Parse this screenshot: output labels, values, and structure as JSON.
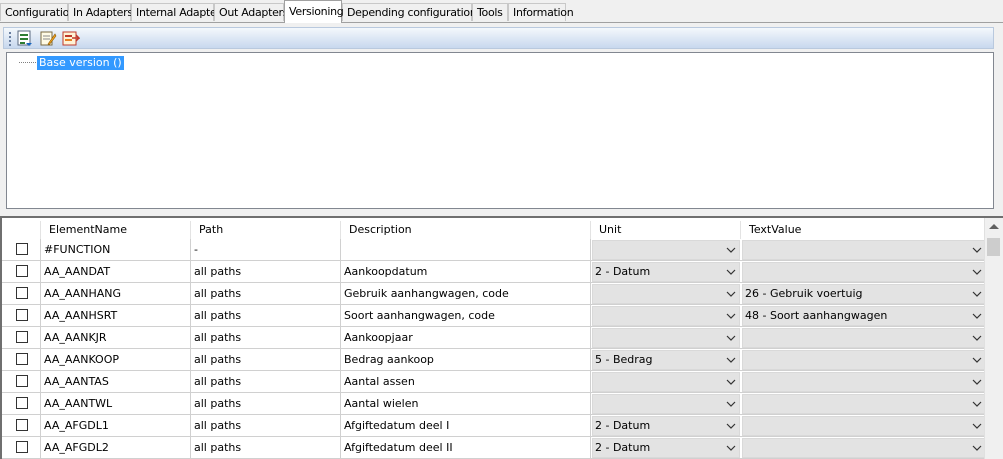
{
  "tabs": [
    "Configuration",
    "In Adapters",
    "Internal Adapter",
    "Out Adapters",
    "Versioning",
    "Depending configurations",
    "Tools",
    "Information"
  ],
  "active_tab": "Versioning",
  "toolbar": {
    "buttons": [
      {
        "icon": "export-data-icon"
      },
      {
        "icon": "edit-document-icon"
      },
      {
        "icon": "import-version-icon"
      }
    ]
  },
  "tree": {
    "nodes": [
      {
        "label": "Base version ()",
        "selected": true
      }
    ]
  },
  "grid": {
    "columns": [
      "",
      "ElementName",
      "Path",
      "Description",
      "Unit",
      "TextValue"
    ],
    "rows": [
      {
        "checked": false,
        "name": "#FUNCTION",
        "path": "-",
        "description": "",
        "unit": "",
        "text_value": ""
      },
      {
        "checked": false,
        "name": "AA_AANDAT",
        "path": "all paths",
        "description": "Aankoopdatum",
        "unit": "2 - Datum",
        "text_value": ""
      },
      {
        "checked": false,
        "name": "AA_AANHANG",
        "path": "all paths",
        "description": "Gebruik aanhangwagen, code",
        "unit": "",
        "text_value": "26 - Gebruik voertuig"
      },
      {
        "checked": false,
        "name": "AA_AANHSRT",
        "path": "all paths",
        "description": "Soort aanhangwagen, code",
        "unit": "",
        "text_value": "48 - Soort aanhangwagen"
      },
      {
        "checked": false,
        "name": "AA_AANKJR",
        "path": "all paths",
        "description": "Aankoopjaar",
        "unit": "",
        "text_value": ""
      },
      {
        "checked": false,
        "name": "AA_AANKOOP",
        "path": "all paths",
        "description": "Bedrag aankoop",
        "unit": "5 - Bedrag",
        "text_value": ""
      },
      {
        "checked": false,
        "name": "AA_AANTAS",
        "path": "all paths",
        "description": "Aantal assen",
        "unit": "",
        "text_value": ""
      },
      {
        "checked": false,
        "name": "AA_AANTWL",
        "path": "all paths",
        "description": "Aantal wielen",
        "unit": "",
        "text_value": ""
      },
      {
        "checked": false,
        "name": "AA_AFGDL1",
        "path": "all paths",
        "description": "Afgiftedatum deel I",
        "unit": "2 - Datum",
        "text_value": ""
      },
      {
        "checked": false,
        "name": "AA_AFGDL2",
        "path": "all paths",
        "description": "Afgiftedatum deel II",
        "unit": "2 - Datum",
        "text_value": ""
      }
    ]
  },
  "colors": {
    "selection": "#3399ff",
    "combo_bg": "#e3e3e3",
    "toolbar_border": "#b9c9de"
  }
}
